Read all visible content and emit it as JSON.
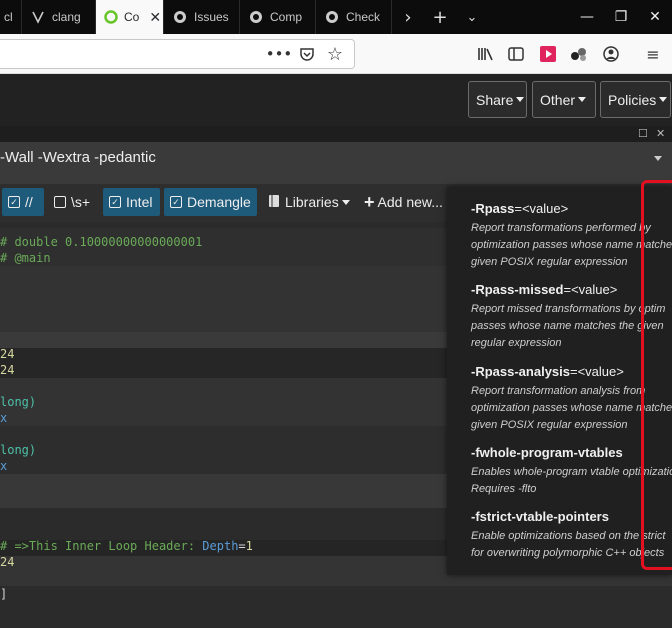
{
  "browser": {
    "tabs": [
      {
        "label": "cl",
        "icon": "clang-icon"
      },
      {
        "label": "clang",
        "icon": "bookmark-icon"
      },
      {
        "label": "Co",
        "icon": "compiler-explorer-icon",
        "active": true
      },
      {
        "label": "Issues",
        "icon": "github-icon"
      },
      {
        "label": "Comp",
        "icon": "github-icon"
      },
      {
        "label": "Check",
        "icon": "github-icon"
      }
    ]
  },
  "header": {
    "share": "Share",
    "other": "Other",
    "policies": "Policies"
  },
  "compiler": {
    "options": "-Wall -Wextra -pedantic"
  },
  "toolbar": {
    "comment": "//",
    "whitespace": "\\s+",
    "intel": "Intel",
    "demangle": "Demangle",
    "libraries": "Libraries",
    "add_new": "Add new..."
  },
  "code": {
    "line1_comment": "# double 0.10000000000000001",
    "line2_comment": "# @main",
    "line3": "24",
    "line4": "24",
    "line5": "long)",
    "line6": "x",
    "line7": "long)",
    "line8": "x",
    "line9_prefix": "# =>This Inner Loop Header: ",
    "line9_depth": "Depth",
    "line9_eq": "=",
    "line9_num": "1",
    "line10": "24",
    "line11": "]"
  },
  "tooltip": {
    "items": [
      {
        "name": "-Rpass",
        "value": "=<value>",
        "desc1": "Report transformations performed by",
        "desc2": "optimization passes whose name matches",
        "desc3": "given POSIX regular expression"
      },
      {
        "name": "-Rpass-missed",
        "value": "=<value>",
        "desc1": "Report missed transformations by optim",
        "desc2": "passes whose name matches the given",
        "desc3": "regular expression"
      },
      {
        "name": "-Rpass-analysis",
        "value": "=<value>",
        "desc1": "Report transformation analysis from",
        "desc2": "optimization passes whose name matches",
        "desc3": "given POSIX regular expression"
      },
      {
        "name": "-fwhole-program-vtables",
        "value": "",
        "desc1": "Enables whole-program vtable optimization",
        "desc2": "Requires -flto",
        "desc3": ""
      },
      {
        "name": "-fstrict-vtable-pointers",
        "value": "",
        "desc1": "Enable optimizations based on the strict",
        "desc2": "for overwriting polymorphic C++ objects",
        "desc3": ""
      }
    ]
  },
  "colors": {
    "annotation": "#e3101f",
    "toolbar_active": "#1e5a7a"
  }
}
